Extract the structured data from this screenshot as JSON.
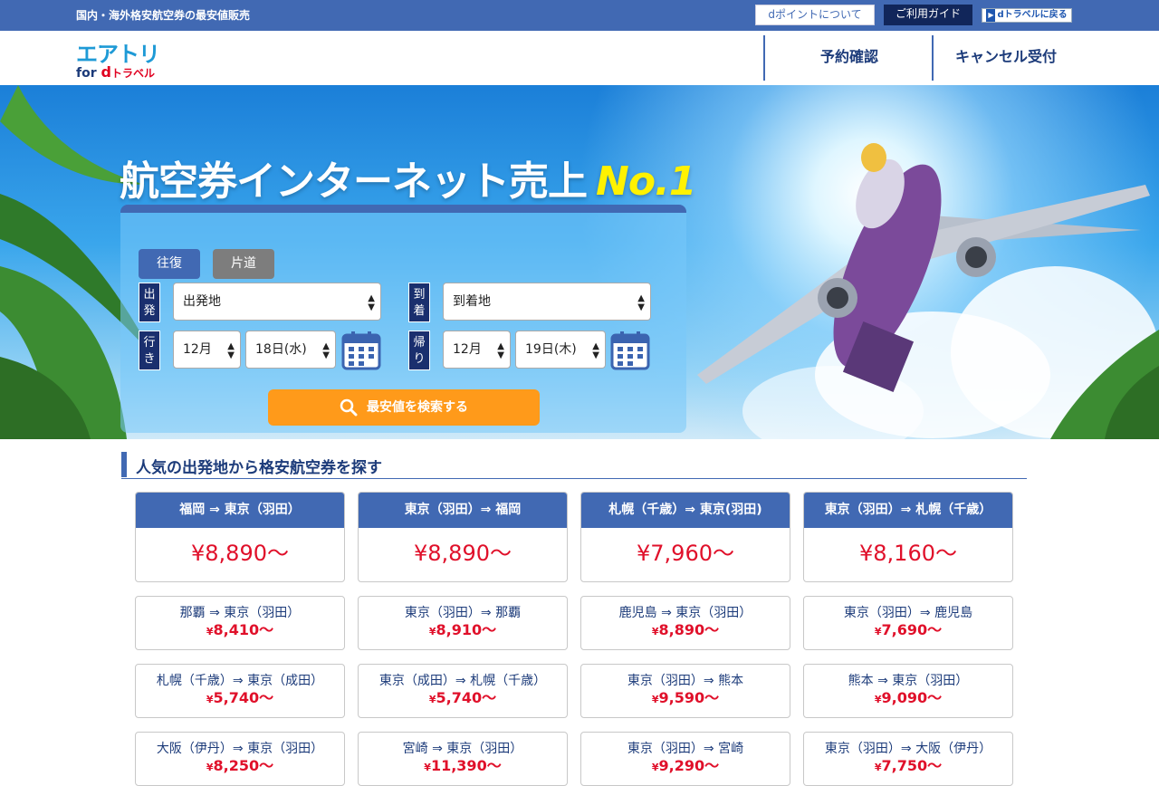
{
  "topbar": {
    "tagline": "国内・海外格安航空券の最安値販売",
    "dpoint_label": "dポイントについて",
    "guide_label": "ご利用ガイド",
    "back_label": "dトラベルに戻る"
  },
  "header": {
    "logo_main": "エアトリ",
    "logo_for": "for",
    "logo_d": "d",
    "logo_travel": "トラベル",
    "nav": [
      "予約確認",
      "キャンセル受付"
    ]
  },
  "hero": {
    "title": "航空券インターネット売上",
    "title_badge": "No.1"
  },
  "search": {
    "trip_round": "往復",
    "trip_oneway": "片道",
    "label_depart_place": "出発",
    "label_arrive_place": "到着",
    "label_outbound": "行き",
    "label_return": "帰り",
    "depart_place": "出発地",
    "arrive_place": "到着地",
    "out_month": "12月",
    "out_day": "18日(水)",
    "ret_month": "12月",
    "ret_day": "19日(木)",
    "submit": "最安値を検索する"
  },
  "section": {
    "title": "人気の出発地から格安航空券を探す"
  },
  "featured": [
    {
      "route": "福岡 ⇒ 東京（羽田）",
      "price": "¥8,890〜"
    },
    {
      "route": "東京（羽田）⇒ 福岡",
      "price": "¥8,890〜"
    },
    {
      "route": "札幌（千歳）⇒ 東京(羽田)",
      "price": "¥7,960〜"
    },
    {
      "route": "東京（羽田）⇒ 札幌（千歳）",
      "price": "¥8,160〜"
    }
  ],
  "routes": [
    {
      "route": "那覇 ⇒ 東京（羽田）",
      "yen": "¥",
      "price": "8,410〜"
    },
    {
      "route": "東京（羽田）⇒ 那覇",
      "yen": "¥",
      "price": "8,910〜"
    },
    {
      "route": "鹿児島 ⇒ 東京（羽田）",
      "yen": "¥",
      "price": "8,890〜"
    },
    {
      "route": "東京（羽田）⇒ 鹿児島",
      "yen": "¥",
      "price": "7,690〜"
    },
    {
      "route": "札幌（千歳）⇒ 東京（成田）",
      "yen": "¥",
      "price": "5,740〜"
    },
    {
      "route": "東京（成田）⇒ 札幌（千歳）",
      "yen": "¥",
      "price": "5,740〜"
    },
    {
      "route": "東京（羽田）⇒ 熊本",
      "yen": "¥",
      "price": "9,590〜"
    },
    {
      "route": "熊本 ⇒ 東京（羽田）",
      "yen": "¥",
      "price": "9,090〜"
    },
    {
      "route": "大阪（伊丹）⇒ 東京（羽田）",
      "yen": "¥",
      "price": "8,250〜"
    },
    {
      "route": "宮崎 ⇒ 東京（羽田）",
      "yen": "¥",
      "price": "11,390〜"
    },
    {
      "route": "東京（羽田）⇒ 宮崎",
      "yen": "¥",
      "price": "9,290〜"
    },
    {
      "route": "東京（羽田）⇒ 大阪（伊丹）",
      "yen": "¥",
      "price": "7,750〜"
    }
  ]
}
